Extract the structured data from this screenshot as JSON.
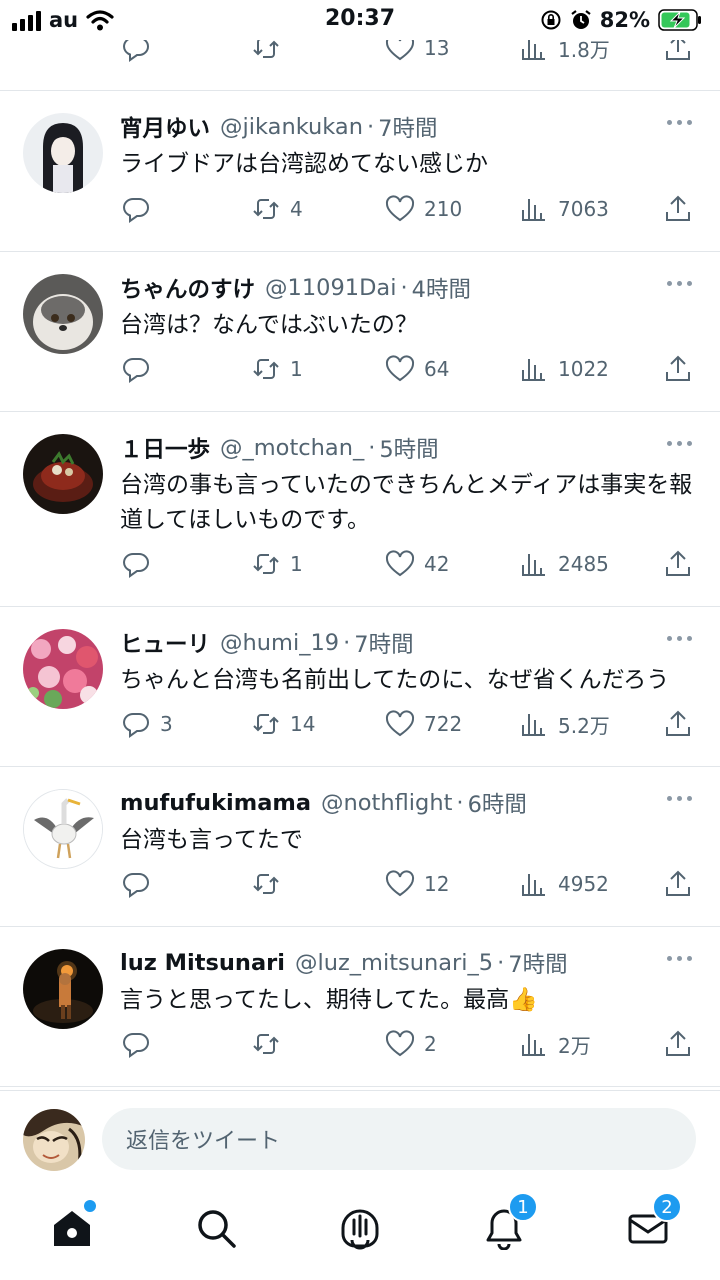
{
  "status_bar": {
    "carrier": "au",
    "time": "20:37",
    "battery": "82%"
  },
  "top_partial": {
    "reply_count": "",
    "retweet_count": "",
    "like_count": "13",
    "view_count": "1.8万"
  },
  "tweets": [
    {
      "name": "宵月ゆい",
      "handle": "@jikankukan",
      "sep": "·",
      "age": "7時間",
      "text": "ライブドアは台湾認めてない感じか",
      "replies": "",
      "retweets": "4",
      "likes": "210",
      "views": "7063"
    },
    {
      "name": "ちゃんのすけ",
      "handle": "@11091Dai",
      "sep": "·",
      "age": "4時間",
      "text": "台湾は？なんではぶいたの？",
      "replies": "",
      "retweets": "1",
      "likes": "64",
      "views": "1022"
    },
    {
      "name": "１日一歩",
      "handle": "@_motchan_",
      "sep": "·",
      "age": "5時間",
      "text": "台湾の事も言っていたのできちんとメディアは事実を報道してほしいものです。",
      "replies": "",
      "retweets": "1",
      "likes": "42",
      "views": "2485"
    },
    {
      "name": "ヒューリ",
      "handle": "@humi_19",
      "sep": "·",
      "age": "7時間",
      "text": "ちゃんと台湾も名前出してたのに、なぜ省くんだろう",
      "replies": "3",
      "retweets": "14",
      "likes": "722",
      "views": "5.2万"
    },
    {
      "name": "mufufukimama",
      "handle": "@nothflight",
      "sep": "·",
      "age": "6時間",
      "text": "台湾も言ってたで",
      "replies": "",
      "retweets": "",
      "likes": "12",
      "views": "4952"
    },
    {
      "name": "luz Mitsunari",
      "handle": "@luz_mitsunari_5",
      "sep": "·",
      "age": "7時間",
      "text": "言うと思ってたし、期待してた。最高👍",
      "replies": "",
      "retweets": "",
      "likes": "2",
      "views": "2万"
    }
  ],
  "reply_bar": {
    "placeholder": "返信をツイート"
  },
  "tabbar": {
    "notifications_badge": "1",
    "messages_badge": "2"
  },
  "colors": {
    "accent": "#1d9bf0",
    "secondary_text": "#536471",
    "divider": "#e2e6ea"
  },
  "icons": [
    "signal-icon",
    "wifi-icon",
    "lock-rotation-icon",
    "alarm-icon",
    "battery-icon",
    "reply-icon",
    "retweet-icon",
    "like-icon",
    "views-icon",
    "share-icon",
    "more-icon",
    "home-icon",
    "search-icon",
    "spaces-icon",
    "notifications-icon",
    "messages-icon"
  ]
}
